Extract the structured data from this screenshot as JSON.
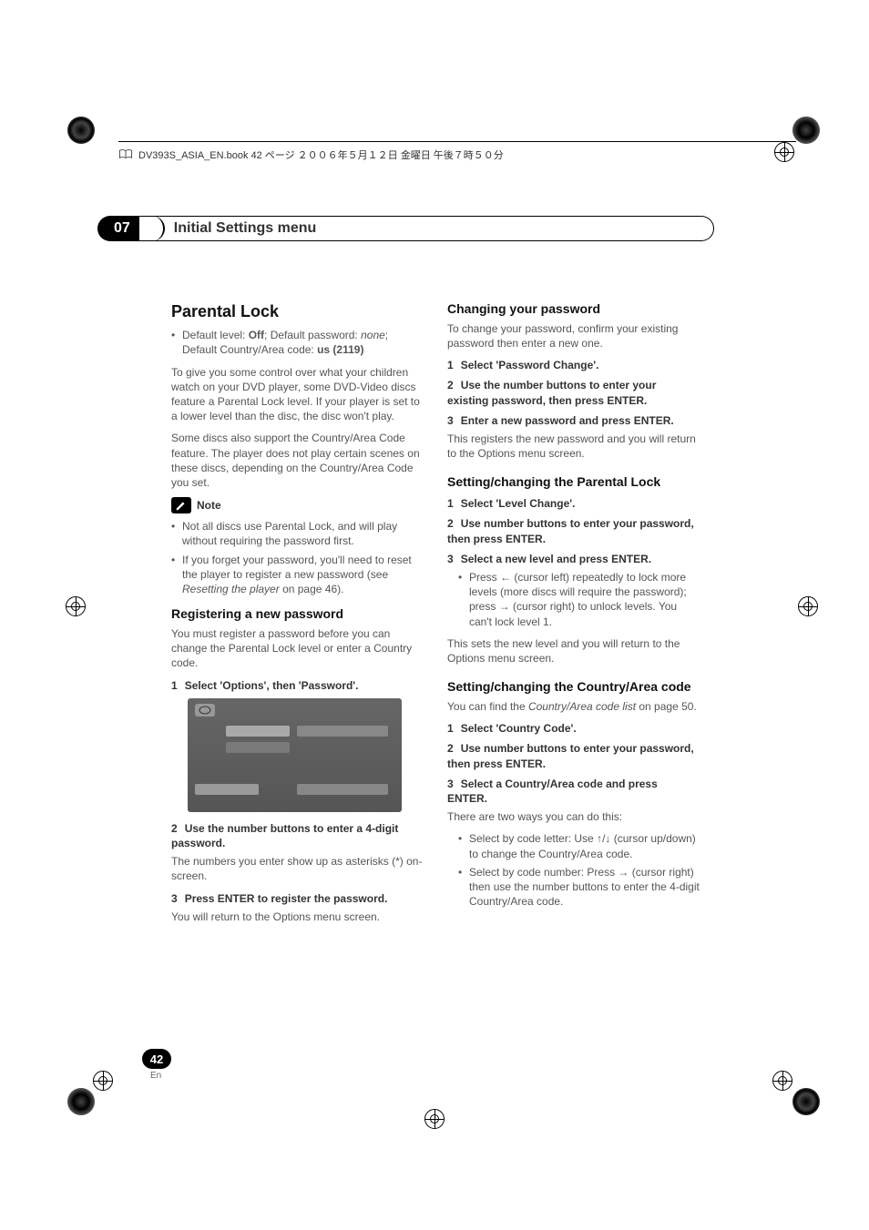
{
  "header": {
    "book_line": "DV393S_ASIA_EN.book 42 ページ ２００６年５月１２日 金曜日 午後７時５０分"
  },
  "chapter": {
    "number": "07",
    "title": "Initial Settings menu"
  },
  "left": {
    "h1": "Parental Lock",
    "default_line_prefix": "Default level: ",
    "default_off": "Off",
    "default_line_mid": "; Default password: ",
    "default_none": "none",
    "default_line_suffix": "; Default Country/Area code: ",
    "default_us": "us (2119)",
    "intro1": "To give you some control over what your children watch on your DVD player, some DVD-Video discs feature a Parental Lock level. If your player is set to a lower level than the disc, the disc won't play.",
    "intro2": "Some discs also support the Country/Area Code feature. The player does not play certain scenes on these discs, depending on the Country/Area Code you set.",
    "note_label": "Note",
    "note_b1": "Not all discs use Parental Lock, and will play without requiring the password first.",
    "note_b2_a": "If you forget your password, you'll need to reset the player to register a new password (see ",
    "note_b2_i": "Resetting the player",
    "note_b2_c": " on page 46).",
    "reg_h2": "Registering a new password",
    "reg_intro": "You must register a password before you can change the Parental Lock level or enter a Country code.",
    "reg_s1_num": "1",
    "reg_s1": "Select 'Options', then 'Password'.",
    "reg_s2_num": "2",
    "reg_s2": "Use the number buttons to enter a 4-digit password.",
    "reg_s2_sub": "The numbers you enter show up as asterisks (*) on-screen.",
    "reg_s3_num": "3",
    "reg_s3": "Press ENTER to register the password.",
    "reg_s3_sub": "You will return to the Options menu screen."
  },
  "right": {
    "chg_h2": "Changing your password",
    "chg_intro": "To change your password, confirm your existing password then enter a new one.",
    "chg_s1_num": "1",
    "chg_s1": "Select 'Password Change'.",
    "chg_s2_num": "2",
    "chg_s2": "Use the number buttons to enter your existing password, then press ENTER.",
    "chg_s3_num": "3",
    "chg_s3": "Enter a new password and press ENTER.",
    "chg_s3_sub": "This registers the new password and you will return to the Options menu screen.",
    "lvl_h2": "Setting/changing the Parental Lock",
    "lvl_s1_num": "1",
    "lvl_s1": "Select 'Level Change'.",
    "lvl_s2_num": "2",
    "lvl_s2": "Use number buttons to enter your password, then press ENTER.",
    "lvl_s3_num": "3",
    "lvl_s3": "Select a new level and press ENTER.",
    "lvl_b1_a": "Press ",
    "lvl_b1_b": " (cursor left) repeatedly to lock more levels (more discs will require the password); press ",
    "lvl_b1_c": " (cursor right) to unlock levels. You can't lock level 1.",
    "lvl_after": "This sets the new level and you will return to the Options menu screen.",
    "ca_h2": "Setting/changing the Country/Area code",
    "ca_intro_a": "You can find the ",
    "ca_intro_i": "Country/Area code list",
    "ca_intro_b": " on page 50.",
    "ca_s1_num": "1",
    "ca_s1": "Select 'Country Code'.",
    "ca_s2_num": "2",
    "ca_s2": "Use number buttons to enter your password, then press ENTER.",
    "ca_s3_num": "3",
    "ca_s3": "Select a Country/Area code and press ENTER.",
    "ca_s3_sub": "There are two ways you can do this:",
    "ca_b1_a": "Select by code letter: Use ",
    "ca_b1_b": " (cursor up/down) to change the Country/Area code.",
    "ca_b2_a": "Select by code number: Press ",
    "ca_b2_b": " (cursor right) then use the number buttons to enter the 4-digit Country/Area code."
  },
  "footer": {
    "page": "42",
    "lang": "En"
  },
  "glyphs": {
    "left_arrow": "←",
    "right_arrow": "→",
    "up_arrow": "↑",
    "down_arrow": "↓",
    "updown": "↑/↓"
  }
}
